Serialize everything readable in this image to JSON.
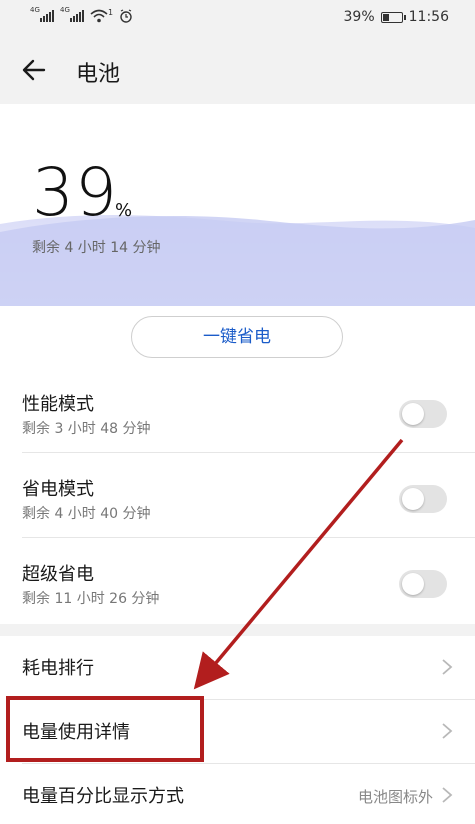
{
  "status_bar": {
    "sig1_tag": "4G",
    "sig2_tag": "4G",
    "wifi_badge": "1",
    "battery_pct": "39%",
    "battery_level": 0.39,
    "time": "11:56",
    "icons": [
      "signal-icon",
      "signal-icon",
      "wifi-icon",
      "alarm-icon",
      "battery-icon"
    ]
  },
  "header": {
    "title": "电池",
    "back_icon": "back-arrow-icon"
  },
  "hero": {
    "percent": "39",
    "percent_sign": "%",
    "remaining": "剩余 4 小时 14 分钟"
  },
  "onekey_button": "一键省电",
  "modes": [
    {
      "title": "性能模式",
      "sub": "剩余 3 小时 48 分钟",
      "enabled": false
    },
    {
      "title": "省电模式",
      "sub": "剩余 4 小时 40 分钟",
      "enabled": false
    },
    {
      "title": "超级省电",
      "sub": "剩余 11 小时 26 分钟",
      "enabled": false
    }
  ],
  "list": [
    {
      "label": "耗电排行",
      "value": ""
    },
    {
      "label": "电量使用详情",
      "value": ""
    },
    {
      "label": "电量百分比显示方式",
      "value": "电池图标外"
    }
  ],
  "colors": {
    "accent": "#1b5cc9",
    "annotation": "#b21e1e",
    "wave": "#c9cdf3",
    "background": "#f2f2f2"
  }
}
